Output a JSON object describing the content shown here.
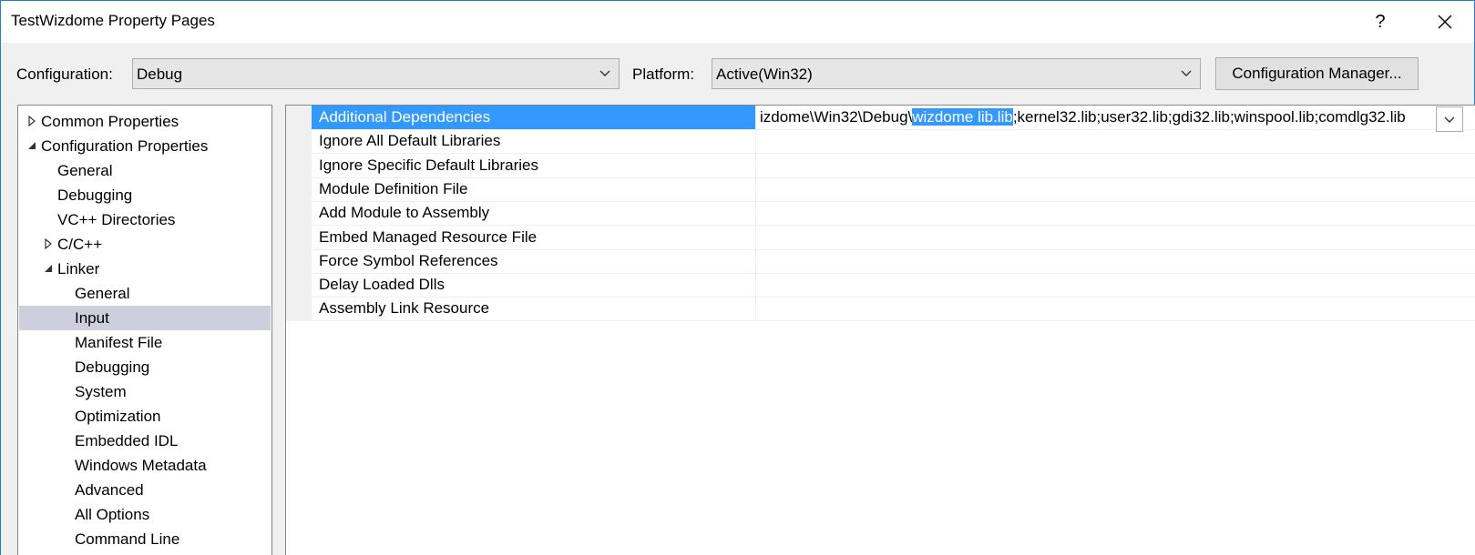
{
  "window": {
    "title": "TestWizdome Property Pages",
    "help_label": "?",
    "close_label": "✕"
  },
  "config_row": {
    "configuration_label": "Configuration:",
    "configuration_value": "Debug",
    "platform_label": "Platform:",
    "platform_value": "Active(Win32)",
    "config_manager_label": "Configuration Manager..."
  },
  "tree": {
    "items": [
      {
        "label": "Common Properties",
        "level": 0,
        "expander": "collapsed"
      },
      {
        "label": "Configuration Properties",
        "level": 0,
        "expander": "expanded"
      },
      {
        "label": "General",
        "level": 1
      },
      {
        "label": "Debugging",
        "level": 1
      },
      {
        "label": "VC++ Directories",
        "level": 1
      },
      {
        "label": "C/C++",
        "level": 1,
        "expander": "collapsed"
      },
      {
        "label": "Linker",
        "level": 1,
        "expander": "expanded"
      },
      {
        "label": "General",
        "level": 2
      },
      {
        "label": "Input",
        "level": 2,
        "selected": true
      },
      {
        "label": "Manifest File",
        "level": 2
      },
      {
        "label": "Debugging",
        "level": 2
      },
      {
        "label": "System",
        "level": 2
      },
      {
        "label": "Optimization",
        "level": 2
      },
      {
        "label": "Embedded IDL",
        "level": 2
      },
      {
        "label": "Windows Metadata",
        "level": 2
      },
      {
        "label": "Advanced",
        "level": 2
      },
      {
        "label": "All Options",
        "level": 2
      },
      {
        "label": "Command Line",
        "level": 2
      }
    ]
  },
  "grid": {
    "rows": [
      {
        "name": "Additional Dependencies",
        "selected": true
      },
      {
        "name": "Ignore All Default Libraries"
      },
      {
        "name": "Ignore Specific Default Libraries"
      },
      {
        "name": "Module Definition File"
      },
      {
        "name": "Add Module to Assembly"
      },
      {
        "name": "Embed Managed Resource File"
      },
      {
        "name": "Force Symbol References"
      },
      {
        "name": "Delay Loaded Dlls"
      },
      {
        "name": "Assembly Link Resource"
      }
    ],
    "dependencies_value": {
      "before": "izdome\\Win32\\Debug\\",
      "highlighted": "wizdome lib.lib",
      "after": ";kernel32.lib;user32.lib;gdi32.lib;winspool.lib;comdlg32.lib"
    }
  },
  "colors": {
    "selection": "#3399ff",
    "tree_selection": "#cdd0dc",
    "window_border": "#1e7fd6"
  }
}
